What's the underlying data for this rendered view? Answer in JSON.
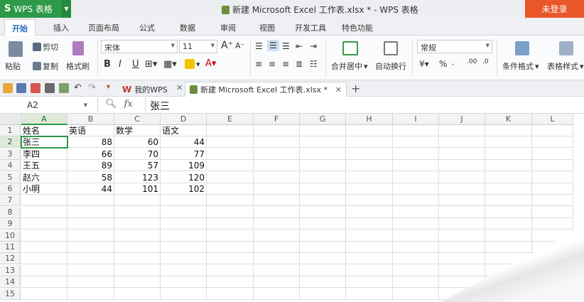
{
  "app": {
    "title": "WPS 表格",
    "logo_letter": "S"
  },
  "window": {
    "title": "新建 Microsoft Excel 工作表.xlsx * - WPS 表格",
    "login_label": "未登录"
  },
  "menu": {
    "tabs": [
      "开始",
      "插入",
      "页面布局",
      "公式",
      "数据",
      "审阅",
      "视图",
      "开发工具",
      "特色功能"
    ]
  },
  "ribbon": {
    "paste": "粘贴",
    "cut": "剪切",
    "copy": "复制",
    "format_painter": "格式刷",
    "font_name": "宋体",
    "font_size": "11",
    "bold": "B",
    "italic": "I",
    "underline": "U",
    "merge_center": "合并居中",
    "wrap_text": "自动换行",
    "number_format": "常规",
    "conditional_format": "条件格式",
    "table_style": "表格样式"
  },
  "doc_tabs": {
    "home": "我的WPS",
    "current": "新建 Microsoft Excel 工作表.xlsx *"
  },
  "formula_bar": {
    "name_box": "A2",
    "fx_label": "fx",
    "content": "张三"
  },
  "grid": {
    "columns": [
      "A",
      "B",
      "C",
      "D",
      "E",
      "F",
      "G",
      "H",
      "I",
      "J",
      "K",
      "L"
    ],
    "rows": [
      "1",
      "2",
      "3",
      "4",
      "5",
      "6",
      "7",
      "8",
      "9",
      "10",
      "11",
      "12",
      "13",
      "14",
      "15"
    ],
    "cells": [
      [
        "姓名",
        "英语",
        "数学",
        "语文"
      ],
      [
        "张三",
        "88",
        "60",
        "44"
      ],
      [
        "李四",
        "66",
        "70",
        "77"
      ],
      [
        "王五",
        "89",
        "57",
        "109"
      ],
      [
        "赵六",
        "58",
        "123",
        "120"
      ],
      [
        "小明",
        "44",
        "101",
        "102"
      ]
    ]
  },
  "colors": {
    "accent": "#2c9a48",
    "login": "#e8562a"
  }
}
